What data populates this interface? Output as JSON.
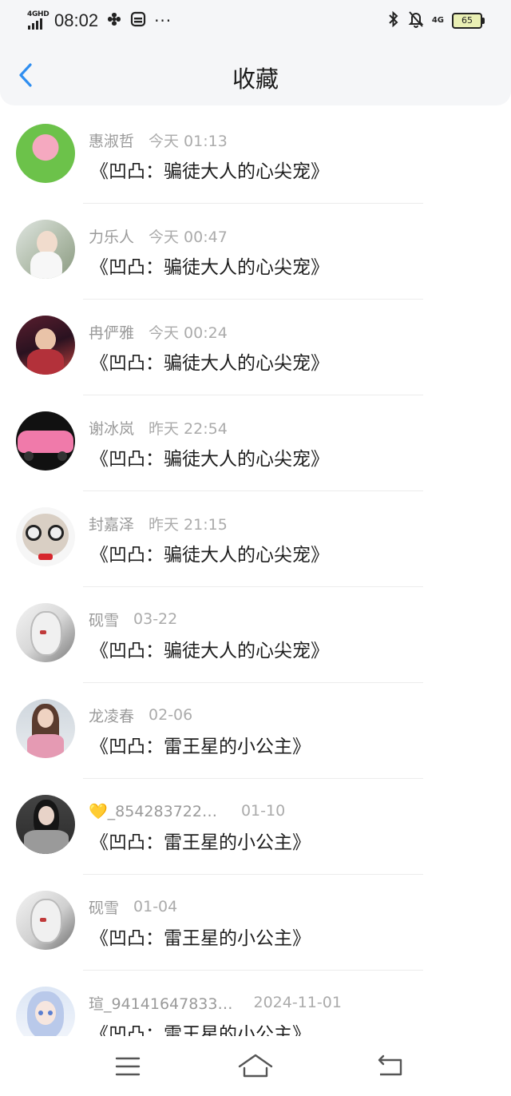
{
  "status_bar": {
    "network": "4GHD",
    "time": "08:02",
    "more": "···",
    "network2": "4G",
    "battery": "65"
  },
  "header": {
    "title": "收藏"
  },
  "items": [
    {
      "name": "惠淑哲",
      "time": "今天 01:13",
      "subject": "《凹凸：骗徒大人的心尖宠》",
      "avatar_colors": [
        "#6cc24a",
        "#f5a9c0"
      ]
    },
    {
      "name": "力乐人",
      "time": "今天 00:47",
      "subject": "《凹凸：骗徒大人的心尖宠》",
      "avatar_colors": [
        "#dfe5e0",
        "#8a9a80"
      ]
    },
    {
      "name": "冉俨雅",
      "time": "今天 00:24",
      "subject": "《凹凸：骗徒大人的心尖宠》",
      "avatar_colors": [
        "#5a1e2e",
        "#c9423f"
      ]
    },
    {
      "name": "谢冰岚",
      "time": "昨天 22:54",
      "subject": "《凹凸：骗徒大人的心尖宠》",
      "avatar_colors": [
        "#1a1a1a",
        "#f07aaa"
      ]
    },
    {
      "name": "封嘉泽",
      "time": "昨天 21:15",
      "subject": "《凹凸：骗徒大人的心尖宠》",
      "avatar_colors": [
        "#f2f2f2",
        "#c9b9a6"
      ]
    },
    {
      "name": "砚雪",
      "time": "03-22",
      "subject": "《凹凸：骗徒大人的心尖宠》",
      "avatar_colors": [
        "#eaeaea",
        "#7b7b7b"
      ]
    },
    {
      "name": "龙凌春",
      "time": "02-06",
      "subject": "《凹凸：雷王星的小公主》",
      "avatar_colors": [
        "#cfd6dd",
        "#e59ab3"
      ]
    },
    {
      "name": "💛_854283722…",
      "time": "01-10",
      "subject": "《凹凸：雷王星的小公主》",
      "avatar_colors": [
        "#2a2a2a",
        "#9a9a9a"
      ]
    },
    {
      "name": "砚雪",
      "time": "01-04",
      "subject": "《凹凸：雷王星的小公主》",
      "avatar_colors": [
        "#eaeaea",
        "#6f6f6f"
      ]
    },
    {
      "name": "瑄_94141647833…",
      "time": "2024-11-01",
      "subject": "《凹凸：雷王星的小公主》",
      "avatar_colors": [
        "#dce6f5",
        "#9fb4e0"
      ]
    }
  ],
  "icons": {
    "back": "chevron-left-icon",
    "menu": "menu-icon",
    "home": "home-icon",
    "return": "return-icon"
  },
  "colors": {
    "accent": "#2f8ef0",
    "header_bg": "#f5f6f8"
  }
}
